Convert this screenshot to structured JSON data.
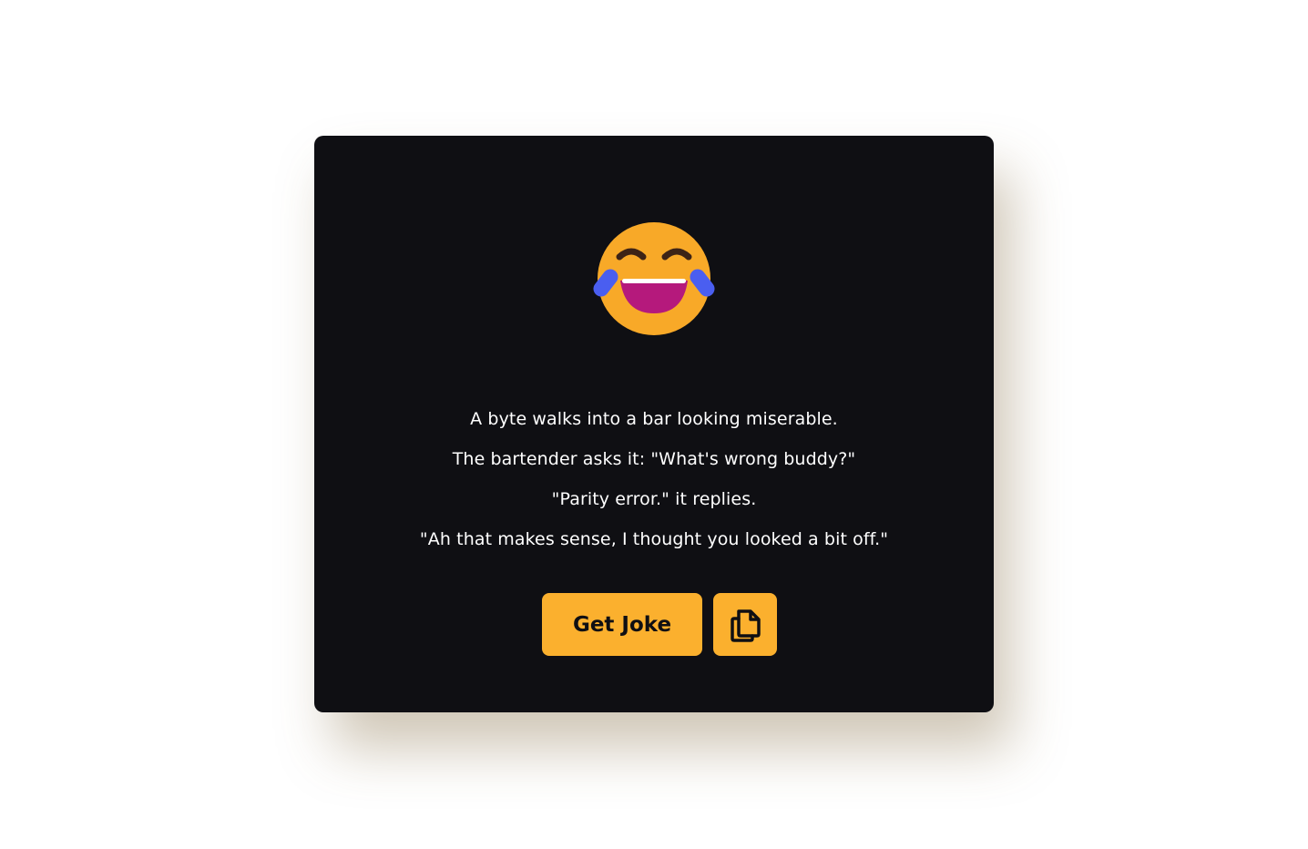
{
  "card": {
    "emoji_icon": "face-with-tears-of-joy-icon",
    "joke_lines": [
      "A byte walks into a bar looking miserable.",
      "The bartender asks it: \"What's wrong buddy?\"",
      "\"Parity error.\" it replies.",
      "\"Ah that makes sense, I thought you looked a bit off.\""
    ]
  },
  "actions": {
    "get_joke_label": "Get Joke",
    "copy_icon": "copy-icon"
  },
  "colors": {
    "page_background": "#ffffff",
    "card_background": "#0f0f13",
    "accent": "#fbb02e",
    "text": "#ffffff"
  }
}
